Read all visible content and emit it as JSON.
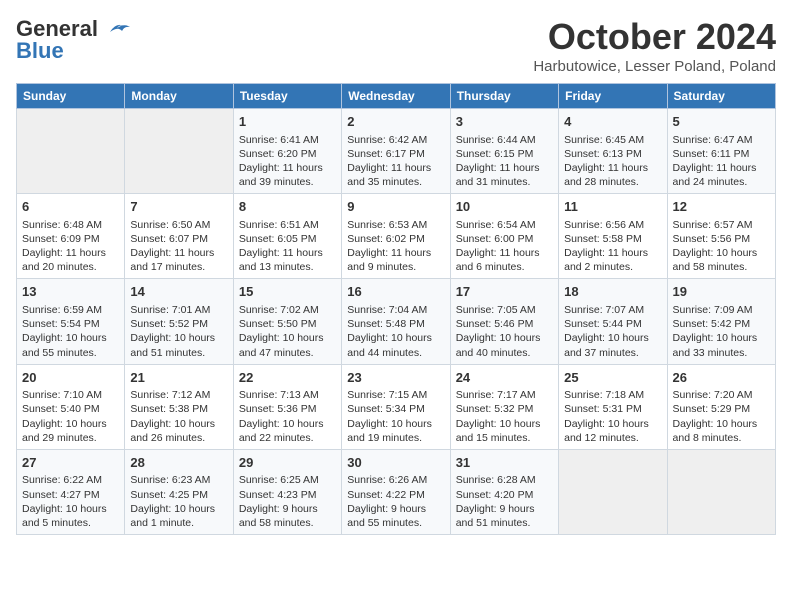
{
  "header": {
    "logo_general": "General",
    "logo_blue": "Blue",
    "month": "October 2024",
    "location": "Harbutowice, Lesser Poland, Poland"
  },
  "days_of_week": [
    "Sunday",
    "Monday",
    "Tuesday",
    "Wednesday",
    "Thursday",
    "Friday",
    "Saturday"
  ],
  "weeks": [
    [
      {
        "day": "",
        "info": ""
      },
      {
        "day": "",
        "info": ""
      },
      {
        "day": "1",
        "info": "Sunrise: 6:41 AM\nSunset: 6:20 PM\nDaylight: 11 hours and 39 minutes."
      },
      {
        "day": "2",
        "info": "Sunrise: 6:42 AM\nSunset: 6:17 PM\nDaylight: 11 hours and 35 minutes."
      },
      {
        "day": "3",
        "info": "Sunrise: 6:44 AM\nSunset: 6:15 PM\nDaylight: 11 hours and 31 minutes."
      },
      {
        "day": "4",
        "info": "Sunrise: 6:45 AM\nSunset: 6:13 PM\nDaylight: 11 hours and 28 minutes."
      },
      {
        "day": "5",
        "info": "Sunrise: 6:47 AM\nSunset: 6:11 PM\nDaylight: 11 hours and 24 minutes."
      }
    ],
    [
      {
        "day": "6",
        "info": "Sunrise: 6:48 AM\nSunset: 6:09 PM\nDaylight: 11 hours and 20 minutes."
      },
      {
        "day": "7",
        "info": "Sunrise: 6:50 AM\nSunset: 6:07 PM\nDaylight: 11 hours and 17 minutes."
      },
      {
        "day": "8",
        "info": "Sunrise: 6:51 AM\nSunset: 6:05 PM\nDaylight: 11 hours and 13 minutes."
      },
      {
        "day": "9",
        "info": "Sunrise: 6:53 AM\nSunset: 6:02 PM\nDaylight: 11 hours and 9 minutes."
      },
      {
        "day": "10",
        "info": "Sunrise: 6:54 AM\nSunset: 6:00 PM\nDaylight: 11 hours and 6 minutes."
      },
      {
        "day": "11",
        "info": "Sunrise: 6:56 AM\nSunset: 5:58 PM\nDaylight: 11 hours and 2 minutes."
      },
      {
        "day": "12",
        "info": "Sunrise: 6:57 AM\nSunset: 5:56 PM\nDaylight: 10 hours and 58 minutes."
      }
    ],
    [
      {
        "day": "13",
        "info": "Sunrise: 6:59 AM\nSunset: 5:54 PM\nDaylight: 10 hours and 55 minutes."
      },
      {
        "day": "14",
        "info": "Sunrise: 7:01 AM\nSunset: 5:52 PM\nDaylight: 10 hours and 51 minutes."
      },
      {
        "day": "15",
        "info": "Sunrise: 7:02 AM\nSunset: 5:50 PM\nDaylight: 10 hours and 47 minutes."
      },
      {
        "day": "16",
        "info": "Sunrise: 7:04 AM\nSunset: 5:48 PM\nDaylight: 10 hours and 44 minutes."
      },
      {
        "day": "17",
        "info": "Sunrise: 7:05 AM\nSunset: 5:46 PM\nDaylight: 10 hours and 40 minutes."
      },
      {
        "day": "18",
        "info": "Sunrise: 7:07 AM\nSunset: 5:44 PM\nDaylight: 10 hours and 37 minutes."
      },
      {
        "day": "19",
        "info": "Sunrise: 7:09 AM\nSunset: 5:42 PM\nDaylight: 10 hours and 33 minutes."
      }
    ],
    [
      {
        "day": "20",
        "info": "Sunrise: 7:10 AM\nSunset: 5:40 PM\nDaylight: 10 hours and 29 minutes."
      },
      {
        "day": "21",
        "info": "Sunrise: 7:12 AM\nSunset: 5:38 PM\nDaylight: 10 hours and 26 minutes."
      },
      {
        "day": "22",
        "info": "Sunrise: 7:13 AM\nSunset: 5:36 PM\nDaylight: 10 hours and 22 minutes."
      },
      {
        "day": "23",
        "info": "Sunrise: 7:15 AM\nSunset: 5:34 PM\nDaylight: 10 hours and 19 minutes."
      },
      {
        "day": "24",
        "info": "Sunrise: 7:17 AM\nSunset: 5:32 PM\nDaylight: 10 hours and 15 minutes."
      },
      {
        "day": "25",
        "info": "Sunrise: 7:18 AM\nSunset: 5:31 PM\nDaylight: 10 hours and 12 minutes."
      },
      {
        "day": "26",
        "info": "Sunrise: 7:20 AM\nSunset: 5:29 PM\nDaylight: 10 hours and 8 minutes."
      }
    ],
    [
      {
        "day": "27",
        "info": "Sunrise: 6:22 AM\nSunset: 4:27 PM\nDaylight: 10 hours and 5 minutes."
      },
      {
        "day": "28",
        "info": "Sunrise: 6:23 AM\nSunset: 4:25 PM\nDaylight: 10 hours and 1 minute."
      },
      {
        "day": "29",
        "info": "Sunrise: 6:25 AM\nSunset: 4:23 PM\nDaylight: 9 hours and 58 minutes."
      },
      {
        "day": "30",
        "info": "Sunrise: 6:26 AM\nSunset: 4:22 PM\nDaylight: 9 hours and 55 minutes."
      },
      {
        "day": "31",
        "info": "Sunrise: 6:28 AM\nSunset: 4:20 PM\nDaylight: 9 hours and 51 minutes."
      },
      {
        "day": "",
        "info": ""
      },
      {
        "day": "",
        "info": ""
      }
    ]
  ]
}
